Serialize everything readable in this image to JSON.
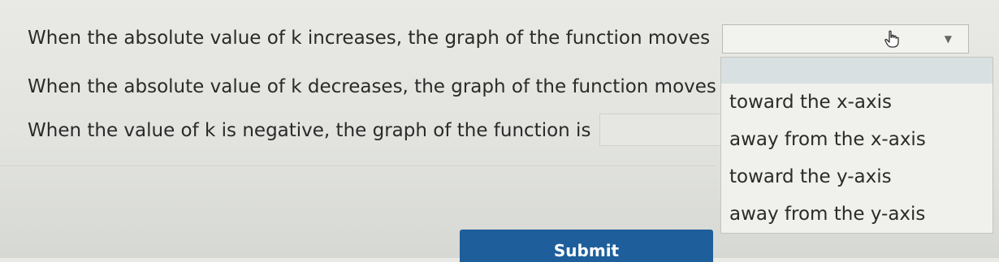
{
  "questions": [
    {
      "text": "When the absolute value of k increases, the graph of the function moves"
    },
    {
      "text": "When the absolute value of k decreases, the graph of the function moves"
    },
    {
      "text": "When the value of k is negative, the graph of the function is"
    }
  ],
  "dropdown": {
    "selected": "",
    "options": [
      "toward the x-axis",
      "away from the x-axis",
      "toward the y-axis",
      "away from the y-axis"
    ]
  },
  "submit_label": "Submit",
  "icons": {
    "cursor": "hand-pointer-icon",
    "arrow": "dropdown-arrow-icon"
  }
}
